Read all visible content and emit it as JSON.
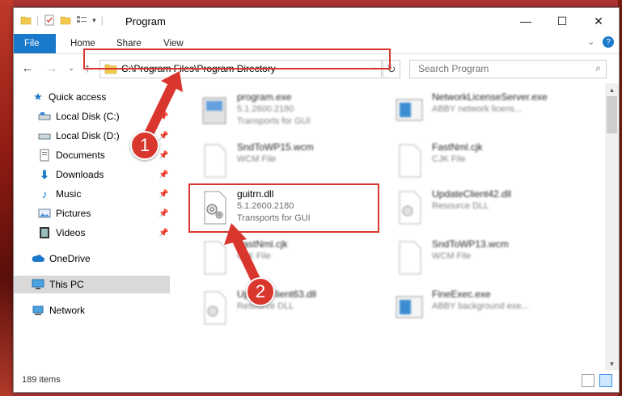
{
  "window": {
    "title": "Program",
    "controls": {
      "minimize": "—",
      "maximize": "☐",
      "close": "✕"
    }
  },
  "ribbon": {
    "tabs": [
      "File",
      "Home",
      "Share",
      "View"
    ]
  },
  "nav": {
    "address": "C:\\Program Files\\Program Directory",
    "search_placeholder": "Search Program"
  },
  "sidebar": {
    "items": [
      {
        "label": "Quick access",
        "icon": "star-icon"
      },
      {
        "label": "Local Disk (C:)",
        "icon": "drive-icon"
      },
      {
        "label": "Local Disk (D:)",
        "icon": "drive-icon"
      },
      {
        "label": "Documents",
        "icon": "documents-icon"
      },
      {
        "label": "Downloads",
        "icon": "download-icon"
      },
      {
        "label": "Music",
        "icon": "music-icon"
      },
      {
        "label": "Pictures",
        "icon": "pictures-icon"
      },
      {
        "label": "Videos",
        "icon": "videos-icon"
      },
      {
        "label": "OneDrive",
        "icon": "cloud-icon"
      },
      {
        "label": "This PC",
        "icon": "computer-icon"
      },
      {
        "label": "Network",
        "icon": "network-icon"
      }
    ]
  },
  "files": [
    {
      "name": "program.exe",
      "line1": "5.1.2600.2180",
      "line2": "Transports for GUI"
    },
    {
      "name": "NetworkLicenseServer.exe",
      "line1": "ABBY network licens...",
      "line2": ""
    },
    {
      "name": "SndToWP15.wcm",
      "line1": "WCM File",
      "line2": ""
    },
    {
      "name": "FastNml.cjk",
      "line1": "CJK File",
      "line2": ""
    },
    {
      "name": "guitrn.dll",
      "line1": "5.1.2600.2180",
      "line2": "Transports for GUI"
    },
    {
      "name": "UpdateClient42.dll",
      "line1": "Resource DLL",
      "line2": ""
    },
    {
      "name": "FastNml.cjk",
      "line1": "CJK File",
      "line2": ""
    },
    {
      "name": "SndToWP13.wcm",
      "line1": "WCM File",
      "line2": ""
    },
    {
      "name": "UpdateClient63.dll",
      "line1": "Resource DLL",
      "line2": ""
    },
    {
      "name": "FineExec.exe",
      "line1": "ABBY background exe...",
      "line2": ""
    }
  ],
  "status": {
    "count": "189 items"
  },
  "callouts": [
    "1",
    "2"
  ],
  "colors": {
    "accent": "#1979ca",
    "highlight": "#d9362d",
    "selected": "#d9d9d9"
  }
}
